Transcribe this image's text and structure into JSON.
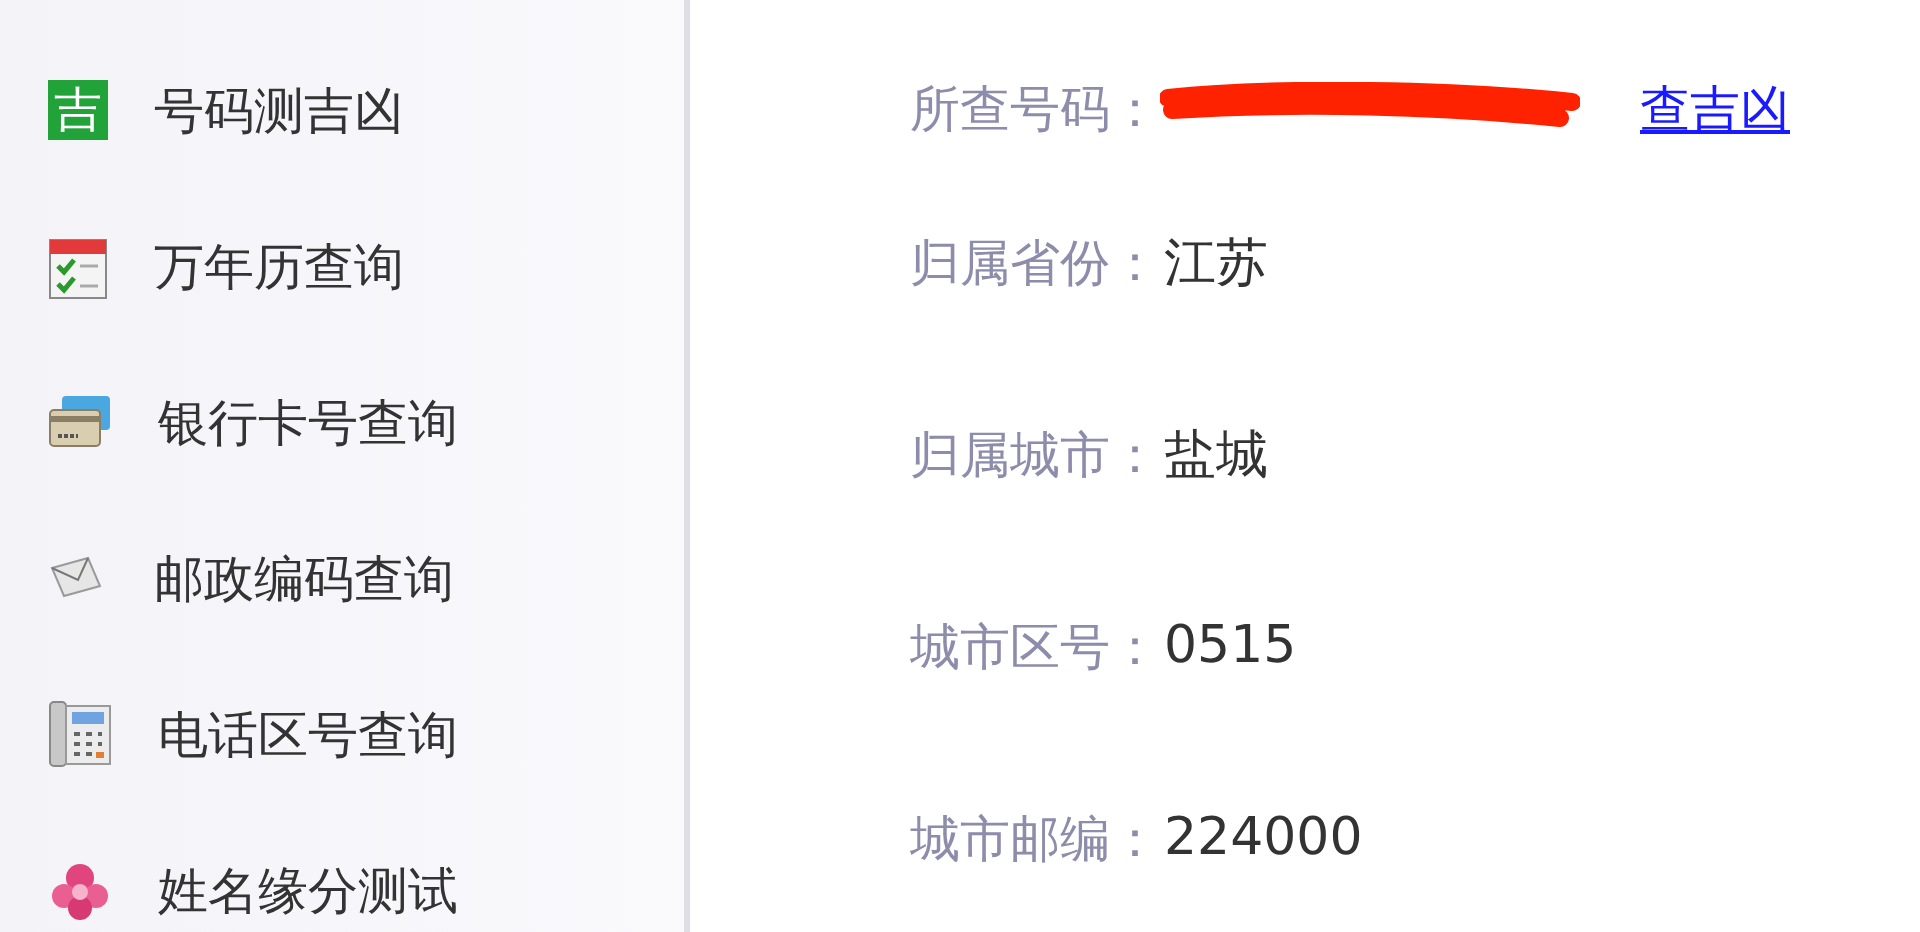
{
  "sidebar": {
    "items": [
      {
        "label": "号码测吉凶",
        "badge": "吉"
      },
      {
        "label": "万年历查询"
      },
      {
        "label": "银行卡号查询"
      },
      {
        "label": "邮政编码查询"
      },
      {
        "label": "电话区号查询"
      },
      {
        "label": "姓名缘分测试"
      }
    ]
  },
  "details": {
    "rows": [
      {
        "label": "所查号码：",
        "redacted": true,
        "link": "查吉凶"
      },
      {
        "label": "归属省份：",
        "value": "江苏"
      },
      {
        "label": "归属城市：",
        "value": "盐城"
      },
      {
        "label": "城市区号：",
        "value": "0515"
      },
      {
        "label": "城市邮编：",
        "value": "224000"
      }
    ]
  }
}
